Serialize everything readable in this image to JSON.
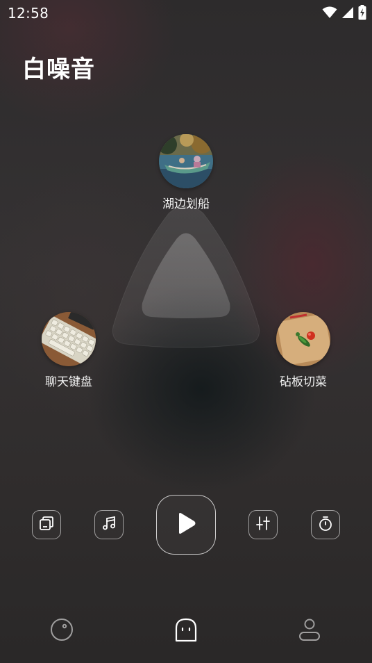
{
  "status_bar": {
    "time": "12:58",
    "icons": [
      "wifi-icon",
      "signal-icon",
      "battery-charging-icon"
    ]
  },
  "header": {
    "title": "白噪音"
  },
  "sounds": [
    {
      "label": "湖边划船",
      "thumbnail": "lake-boat-photo"
    },
    {
      "label": "聊天键盘",
      "thumbnail": "keyboard-photo"
    },
    {
      "label": "砧板切菜",
      "thumbnail": "cutting-board-photo"
    }
  ],
  "controls": {
    "buttons": [
      "layers-icon",
      "music-note-icon",
      "play-icon",
      "equalizer-icon",
      "timer-icon"
    ]
  },
  "bottom_nav": {
    "items": [
      "discover-icon",
      "white-noise-icon",
      "profile-icon"
    ],
    "active": "white-noise-icon"
  },
  "colors": {
    "background": "#302d2d",
    "text": "#ffffff",
    "icon_outline": "#ffffffcc"
  }
}
